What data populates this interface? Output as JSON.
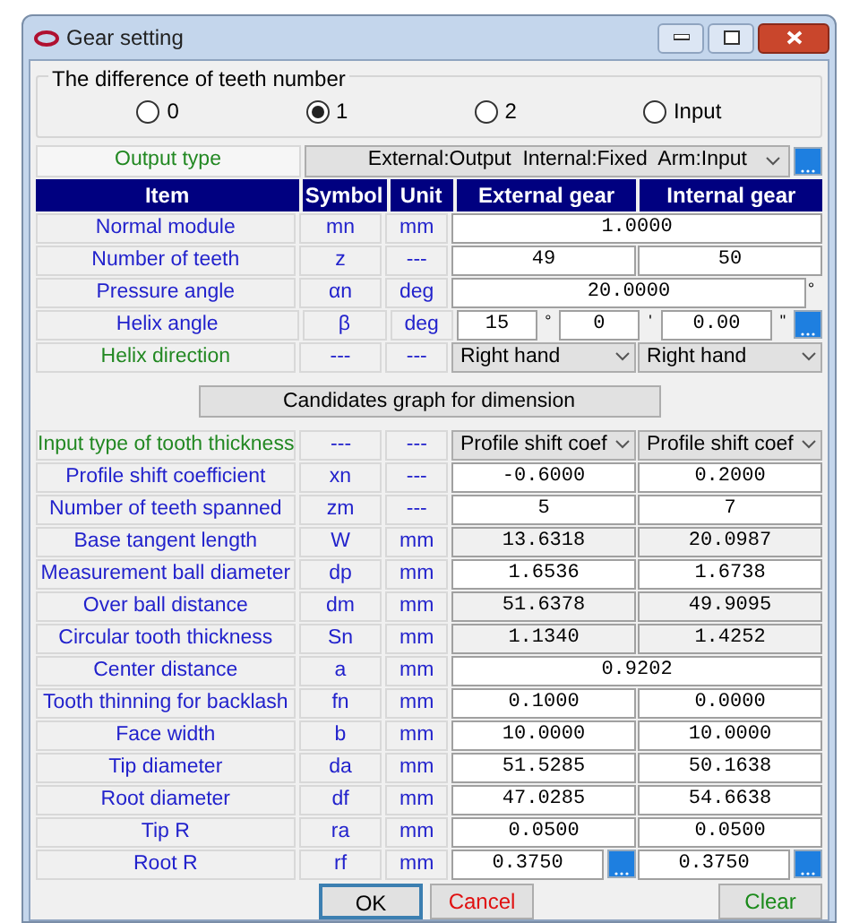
{
  "window": {
    "title": "Gear setting"
  },
  "teeth_difference": {
    "title": "The difference of teeth number",
    "options": [
      {
        "label": "0",
        "selected": false
      },
      {
        "label": "1",
        "selected": true
      },
      {
        "label": "2",
        "selected": false
      },
      {
        "label": "Input",
        "selected": false
      }
    ]
  },
  "output_type": {
    "label": "Output type",
    "value": "External:Output  Internal:Fixed  Arm:Input"
  },
  "table": {
    "columns": [
      "Item",
      "Symbol",
      "Unit",
      "External gear",
      "Internal gear"
    ],
    "rows_top": [
      {
        "item": "Normal module",
        "color": "#2222cc",
        "symbol": "mn",
        "unit": "mm",
        "kind": "merged",
        "values": [
          "1.0000"
        ]
      },
      {
        "item": "Number of teeth",
        "color": "#2222cc",
        "symbol": "z",
        "unit": "---",
        "kind": "pair",
        "values": [
          "49",
          "50"
        ]
      },
      {
        "item": "Pressure angle",
        "color": "#2222cc",
        "symbol": "αn",
        "unit": "deg",
        "kind": "merged",
        "values": [
          "20.0000"
        ],
        "suffix": "°"
      },
      {
        "item": "Helix angle",
        "color": "#2222cc",
        "symbol": "β",
        "unit": "deg",
        "kind": "angle",
        "parts": [
          {
            "value": "15",
            "unit": "°"
          },
          {
            "value": "0",
            "unit": "'"
          },
          {
            "value": "0.00",
            "unit": "\""
          }
        ]
      },
      {
        "item": "Helix direction",
        "color": "#228822",
        "symbol": "---",
        "unit": "---",
        "kind": "select",
        "values": [
          "Right hand",
          "Right hand"
        ]
      }
    ],
    "candidates_button": "Candidates graph for dimension",
    "rows_bottom": [
      {
        "item": "Input type of tooth thickness",
        "color": "#228822",
        "symbol": "---",
        "unit": "---",
        "kind": "select",
        "values": [
          "Profile shift coef",
          "Profile shift coef"
        ]
      },
      {
        "item": "Profile shift coefficient",
        "color": "#2222cc",
        "symbol": "xn",
        "unit": "---",
        "kind": "pair",
        "values": [
          "-0.6000",
          "0.2000"
        ]
      },
      {
        "item": "Number of teeth spanned",
        "color": "#2222cc",
        "symbol": "zm",
        "unit": "---",
        "kind": "pair",
        "values": [
          "5",
          "7"
        ]
      },
      {
        "item": "Base tangent length",
        "color": "#2222cc",
        "symbol": "W",
        "unit": "mm",
        "kind": "readonly",
        "values": [
          "13.6318",
          "20.0987"
        ]
      },
      {
        "item": "Measurement ball diameter",
        "color": "#2222cc",
        "symbol": "dp",
        "unit": "mm",
        "kind": "pair",
        "values": [
          "1.6536",
          "1.6738"
        ]
      },
      {
        "item": "Over ball distance",
        "color": "#2222cc",
        "symbol": "dm",
        "unit": "mm",
        "kind": "readonly",
        "values": [
          "51.6378",
          "49.9095"
        ]
      },
      {
        "item": "Circular tooth thickness",
        "color": "#2222cc",
        "symbol": "Sn",
        "unit": "mm",
        "kind": "readonly",
        "values": [
          "1.1340",
          "1.4252"
        ]
      },
      {
        "item": "Center distance",
        "color": "#2222cc",
        "symbol": "a",
        "unit": "mm",
        "kind": "merged",
        "values": [
          "0.9202"
        ]
      },
      {
        "item": "Tooth thinning for backlash",
        "color": "#2222cc",
        "symbol": "fn",
        "unit": "mm",
        "kind": "pair",
        "values": [
          "0.1000",
          "0.0000"
        ]
      },
      {
        "item": "Face width",
        "color": "#2222cc",
        "symbol": "b",
        "unit": "mm",
        "kind": "pair",
        "values": [
          "10.0000",
          "10.0000"
        ]
      },
      {
        "item": "Tip diameter",
        "color": "#2222cc",
        "symbol": "da",
        "unit": "mm",
        "kind": "pair",
        "values": [
          "51.5285",
          "50.1638"
        ]
      },
      {
        "item": "Root diameter",
        "color": "#2222cc",
        "symbol": "df",
        "unit": "mm",
        "kind": "pair",
        "values": [
          "47.0285",
          "54.6638"
        ]
      },
      {
        "item": "Tip R",
        "color": "#2222cc",
        "symbol": "ra",
        "unit": "mm",
        "kind": "pair",
        "values": [
          "0.0500",
          "0.0500"
        ]
      },
      {
        "item": "Root R",
        "color": "#2222cc",
        "symbol": "rf",
        "unit": "mm",
        "kind": "pair_button",
        "values": [
          "0.3750",
          "0.3750"
        ]
      }
    ]
  },
  "buttons": [
    {
      "label": "OK",
      "kind": "ok"
    },
    {
      "label": "Cancel",
      "kind": "cancel"
    },
    {
      "label": "Clear",
      "kind": "clear"
    }
  ]
}
